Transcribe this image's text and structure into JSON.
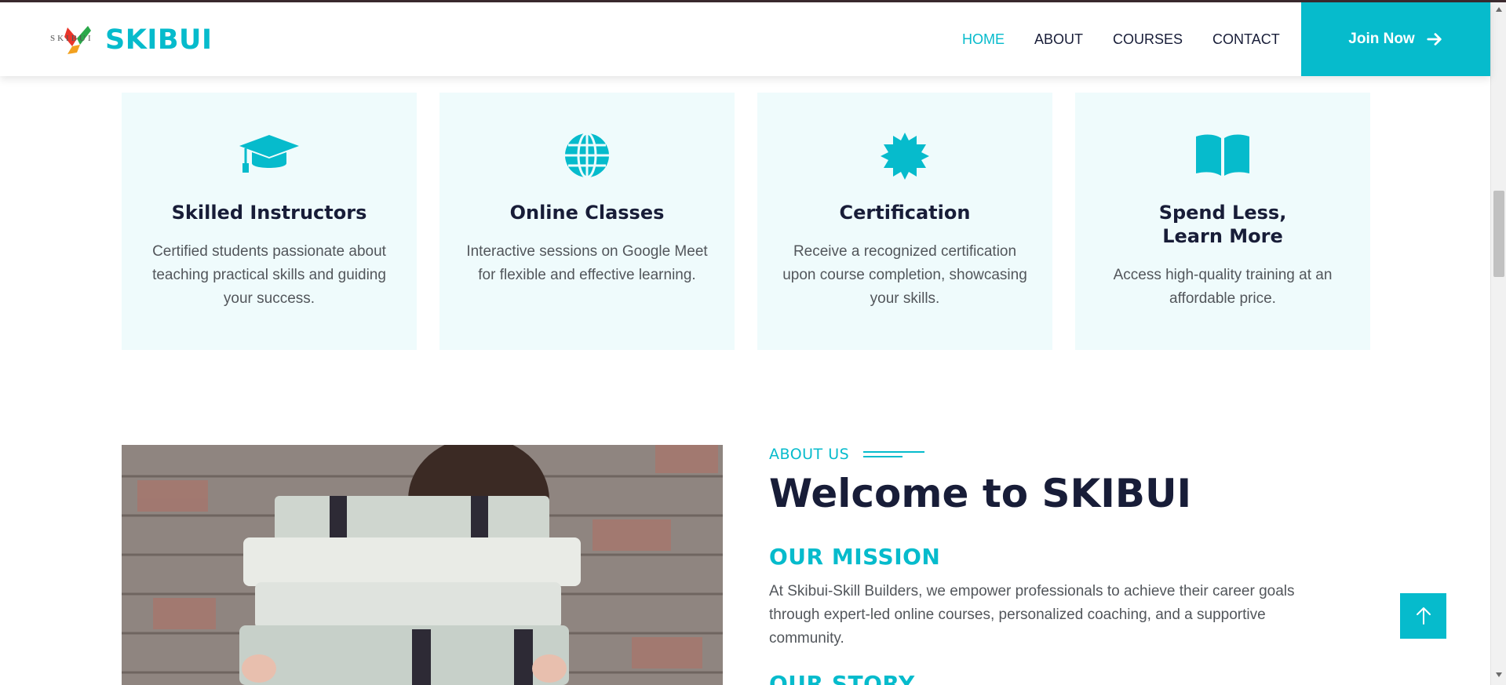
{
  "brand": {
    "logo_small": "SKIBUI",
    "logo_text": "SKIBUI",
    "accent": "#06bbcc",
    "dark": "#181d38"
  },
  "nav": {
    "items": [
      {
        "label": "HOME",
        "active": true
      },
      {
        "label": "ABOUT",
        "active": false
      },
      {
        "label": "COURSES",
        "active": false
      },
      {
        "label": "CONTACT",
        "active": false
      }
    ],
    "join_label": "Join Now",
    "join_icon": "arrow-right-icon"
  },
  "features": [
    {
      "icon": "graduation-cap-icon",
      "title": "Skilled Instructors",
      "desc": "Certified students passionate about teaching practical skills and guiding your success."
    },
    {
      "icon": "globe-icon",
      "title": "Online Classes",
      "desc": "Interactive sessions on Google Meet for flexible and effective learning."
    },
    {
      "icon": "certificate-icon",
      "title": "Certification",
      "desc": "Receive a recognized certification upon course completion, showcasing your skills."
    },
    {
      "icon": "book-open-icon",
      "title": "Spend Less, Learn More",
      "title_line1": "Spend Less,",
      "title_line2": "Learn More",
      "desc": "Access high-quality training at an affordable price."
    }
  ],
  "about": {
    "label": "ABOUT US",
    "heading": "Welcome to SKIBUI",
    "mission_title": "OUR MISSION",
    "mission_text": "At Skibui-Skill Builders, we empower professionals to achieve their career goals through expert-led online courses, personalized coaching, and a supportive community.",
    "story_title": "OUR STORY",
    "image": "person-holding-stack-of-books-photo"
  },
  "back_to_top_icon": "arrow-up-icon"
}
